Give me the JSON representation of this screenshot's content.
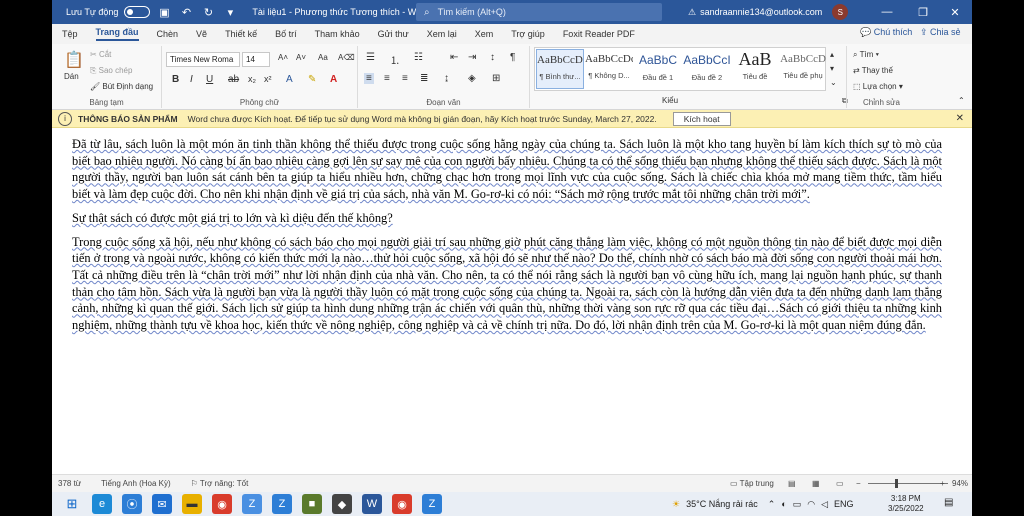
{
  "titlebar": {
    "autosave_label": "Lưu Tự động",
    "doc_title": "Tài liệu1 - Phương thức Tương thích - Word",
    "search_placeholder": "Tìm kiếm (Alt+Q)",
    "user_email": "sandraannie134@outlook.com",
    "user_initial": "S",
    "minimize": "—",
    "restore": "❐",
    "close": "✕"
  },
  "tabs": {
    "items": [
      "Tệp",
      "Trang đầu",
      "Chèn",
      "Vẽ",
      "Thiết kế",
      "Bố trí",
      "Tham khảo",
      "Gửi thư",
      "Xem lại",
      "Xem",
      "Trợ giúp",
      "Foxit Reader PDF"
    ],
    "comment": "Chú thích",
    "share": "Chia sẻ"
  },
  "ribbon": {
    "clipboard": {
      "paste": "Dán",
      "cut": "Cắt",
      "copy": "Sao chép",
      "format_painter": "Bút Định dạng",
      "label": "Bảng tạm"
    },
    "font": {
      "name": "Times New Roma",
      "size": "14",
      "label": "Phông chữ"
    },
    "paragraph": {
      "label": "Đoạn văn"
    },
    "styles": {
      "items": [
        {
          "preview": "AaBbCcDc",
          "name": "¶ Bình thư..."
        },
        {
          "preview": "AaBbCcDc",
          "name": "¶ Không D..."
        },
        {
          "preview": "AaBbC",
          "name": "Đầu đề 1"
        },
        {
          "preview": "AaBbCcI",
          "name": "Đầu đề 2"
        },
        {
          "preview": "AaB",
          "name": "Tiêu đề"
        },
        {
          "preview": "AaBbCcD",
          "name": "Tiêu đề phụ"
        }
      ],
      "label": "Kiểu"
    },
    "editing": {
      "find": "Tìm",
      "replace": "Thay thế",
      "select": "Lựa chọn",
      "label": "Chỉnh sửa"
    }
  },
  "message_bar": {
    "title": "THÔNG BÁO SẢN PHẨM",
    "text": "Word chưa được Kích hoạt. Để tiếp tục sử dụng Word mà không bị gián đoạn, hãy Kích hoạt trước Sunday, March 27, 2022.",
    "button": "Kích hoạt"
  },
  "document": {
    "paragraphs": [
      "Đã từ lâu, sách luôn là một món ăn tinh thần không thể thiếu được trong cuộc sống hằng ngày của chúng ta. Sách luôn là một kho tang huyền bí làm kích thích sự tò mò của biết bao nhiêu người. Nó càng bí ẩn bao nhiêu càng gợi lên sự say mê của con người bấy nhiêu. Chúng ta có thể sống thiếu bạn nhưng không thể thiếu sách được. Sách là một người thầy, người bạn luôn sát cánh bên ta giúp ta hiểu nhiều hơn, chững chạc hơn trong mọi lĩnh vực của cuộc sống. Sách là chiếc chìa khóa mở mang tiềm thức, tầm hiểu biết và làm đẹp cuộc đời. Cho nên khi nhận định về giá trị của sách, nhà văn M. Go-rơ-ki có nói: “Sách mở rộng trước mắt tôi những chân trời mới”.",
      "Sự thật sách có được một giá trị to lớn và kì diệu đến thế không?",
      "Trong cuộc sống xã hội, nếu như không có sách báo cho mọi người giải trí sau những giờ phút căng thẳng làm việc, không có một nguồn thông tin nào để biết được mọi diễn tiến ở trong và ngoài nước, không có kiến thức mới lạ nào…thử hỏi cuộc sống, xã hội đó sẽ như thế nào? Do thế, chính nhờ có sách báo mà đời sống con người thoải mái hơn. Tất cả những điều trên là “chân trời mới” như lời nhận định của nhà văn. Cho nên, ta có thể nói rằng sách là người bạn vô cùng hữu ích, mang lại nguồn hạnh phúc, sự thanh thản cho tâm hồn. Sách vừa là người bạn vừa là người thầy luôn có mặt trong cuộc sống của chúng ta. Ngoài ra, sách còn là hướng dẫn viên đưa ta đến những danh lam thắng cảnh, những kì quan thế giới. Sách lịch sử giúp ta hình dung những trận ác chiến với quân thù, những thời vàng son rực rỡ  qua các tiều đại…Sách có giới thiệu ta những kinh nghiệm, những thành tựu về khoa học, kiến thức về nông nghiệp, công nghiệp và cả về chính trị nữa. Do đó, lời nhận định trên của M. Go-rơ-ki là một quan niệm đúng đắn."
    ]
  },
  "statusbar": {
    "words": "378 từ",
    "language": "Tiếng Anh (Hoa Kỳ)",
    "accessibility": "Trợ năng: Tốt",
    "focus": "Tập trung",
    "zoom": "94%"
  },
  "taskbar": {
    "weather": "35°C  Nắng rải rác",
    "lang": "ENG",
    "time": "3:18 PM",
    "date": "3/25/2022"
  }
}
